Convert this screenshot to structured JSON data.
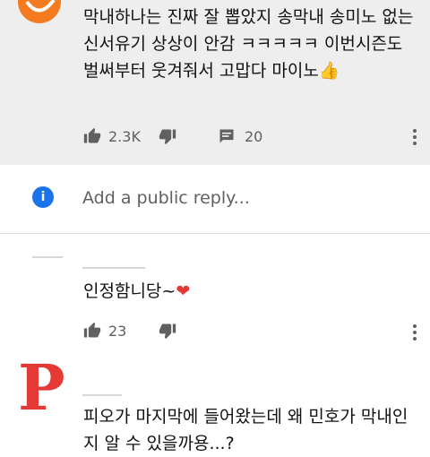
{
  "comments": [
    {
      "text": "막내하나는 진짜 잘 뽑았지 송막내 송미노 없는 신서유기 상상이 안감 ㅋㅋㅋㅋㅋ 이번시즌도 벌써부터 웃겨줘서 고맙다 마이노",
      "emoji": "👍",
      "likes": "2.3K",
      "replies": "20"
    },
    {
      "text": "인정함니당~",
      "emoji": "❤",
      "likes": "23"
    },
    {
      "avatar_letter": "P",
      "text": "피오가 마지막에 들어왔는데 왜 민호가 막내인지 알 수 있을까용...?"
    }
  ],
  "reply_box": {
    "avatar_letter": "i",
    "placeholder": "Add a public reply..."
  },
  "icons": [
    "like-icon",
    "dislike-icon",
    "reply-count-icon",
    "more-options-icon",
    "info-icon"
  ],
  "colors": {
    "highlight_bg": "#eeeeee",
    "icon_grey": "#606060",
    "info_avatar": "#1a73e8",
    "p_avatar": "#e53935",
    "orange_avatar": "#f47b20",
    "heart": "#e53935"
  }
}
